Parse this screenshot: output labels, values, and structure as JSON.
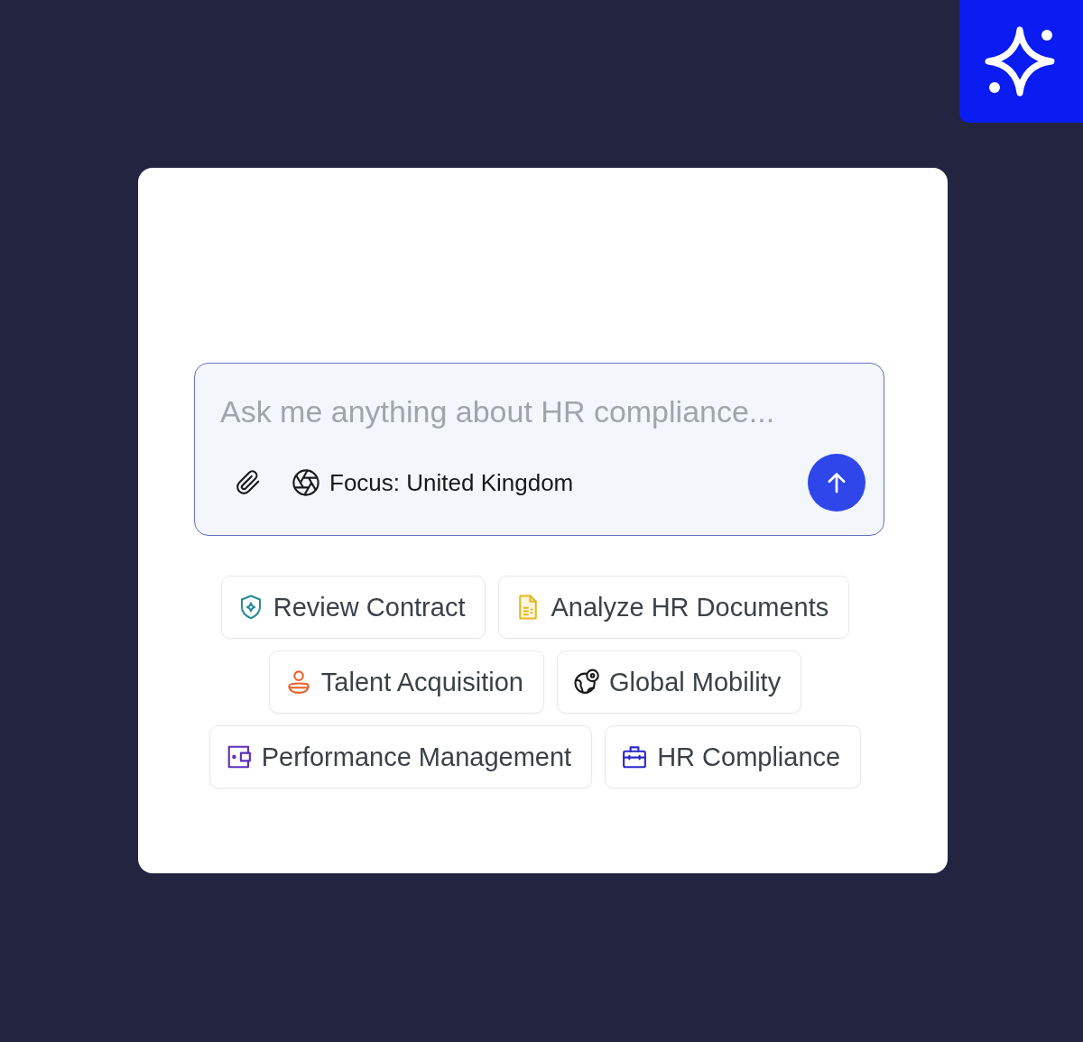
{
  "composer": {
    "placeholder": "Ask me anything about HR compliance...",
    "focus_label": "Focus: United Kingdom"
  },
  "suggestions": {
    "rows": [
      {
        "chips": [
          {
            "label": "Review Contract",
            "color": "#2a8a98"
          },
          {
            "label": "Analyze HR Documents",
            "color": "#e2b71f"
          }
        ]
      },
      {
        "chips": [
          {
            "label": "Talent Acquisition",
            "color": "#e8622a"
          },
          {
            "label": "Global Mobility",
            "color": "#1a1a1a"
          }
        ]
      },
      {
        "chips": [
          {
            "label": "Performance Management",
            "color": "#5b2fc0"
          },
          {
            "label": "HR Compliance",
            "color": "#2a2ac8"
          }
        ]
      }
    ]
  }
}
